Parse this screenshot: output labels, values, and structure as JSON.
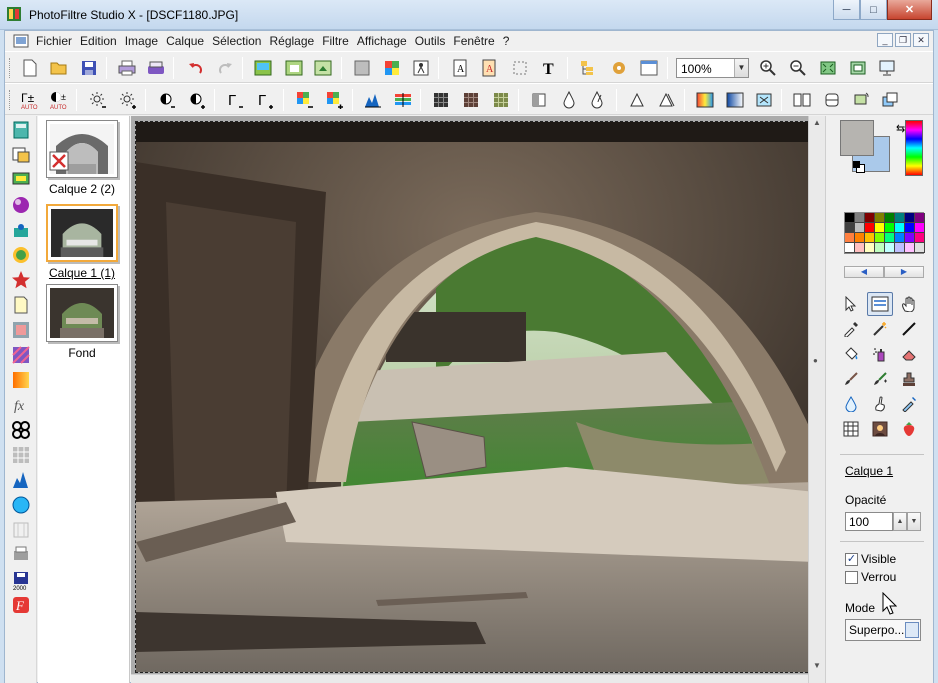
{
  "window": {
    "title": "PhotoFiltre Studio X - [DSCF1180.JPG]",
    "minimize_icon": "minimize-icon",
    "maximize_icon": "maximize-icon",
    "close_icon": "close-icon"
  },
  "menubar": {
    "items": [
      "Fichier",
      "Edition",
      "Image",
      "Calque",
      "Sélection",
      "Réglage",
      "Filtre",
      "Affichage",
      "Outils",
      "Fenêtre",
      "?"
    ]
  },
  "toolbar": {
    "zoom_value": "100%"
  },
  "layers": [
    {
      "label": "Calque 2 (2)",
      "selected": false,
      "hidden_icon": "hidden-layer-icon"
    },
    {
      "label": "Calque 1 (1)",
      "selected": true
    },
    {
      "label": "Fond",
      "selected": false
    }
  ],
  "right_panel": {
    "foreground_color": "#b6b4b0",
    "background_color": "#aac9ea",
    "palette": [
      "#000000",
      "#7f7f7f",
      "#7f0000",
      "#7f7f00",
      "#007f00",
      "#007f7f",
      "#00007f",
      "#7f007f",
      "#404040",
      "#bfbfbf",
      "#ff0000",
      "#ffff00",
      "#00ff00",
      "#00ffff",
      "#0000ff",
      "#ff00ff",
      "#ff8040",
      "#ff8000",
      "#ffbf00",
      "#80ff00",
      "#00ff80",
      "#0080ff",
      "#8000ff",
      "#ff0080",
      "#ffffff",
      "#ffbfbf",
      "#ffffbf",
      "#bfffbf",
      "#bfffff",
      "#bfbfff",
      "#ffbfff",
      "#e0e0e0"
    ],
    "layer_name": "Calque 1",
    "opacity_label": "Opacité",
    "opacity_value": "100",
    "visible_label": "Visible",
    "visible_checked": true,
    "lock_label": "Verrou",
    "lock_checked": false,
    "mode_label": "Mode",
    "mode_value": "Superpo..."
  }
}
